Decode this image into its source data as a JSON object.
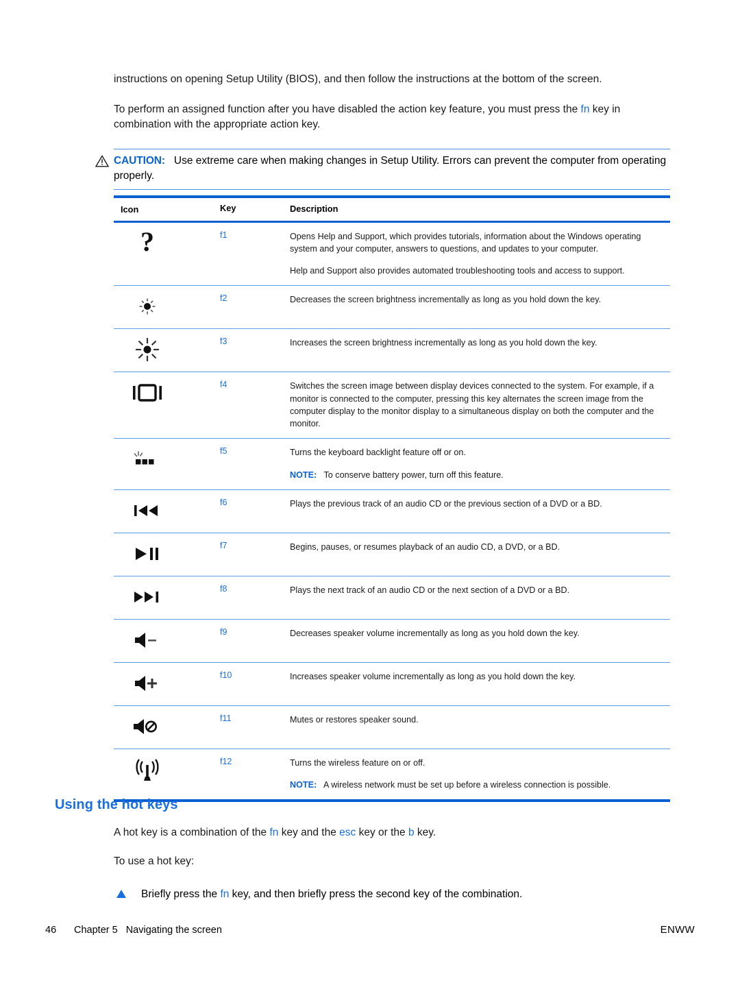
{
  "document": {
    "intro_paragraphs": [
      {
        "segments": [
          {
            "text": "instructions on opening Setup Utility (BIOS), and then follow the instructions at the bottom of the screen.",
            "style": "normal"
          }
        ]
      },
      {
        "segments": [
          {
            "text": "To perform an assigned function after you have disabled the action key feature, you must press the ",
            "style": "normal"
          },
          {
            "text": "fn",
            "style": "key"
          },
          {
            "text": " key in combination with the appropriate action key.",
            "style": "normal"
          }
        ]
      }
    ],
    "caution": {
      "icon": "warning-triangle-icon",
      "label": "CAUTION:",
      "text": "Use extreme care when making changes in Setup Utility. Errors can prevent the computer from operating properly."
    },
    "table": {
      "headers": [
        "Icon",
        "Key",
        "Description"
      ],
      "rows": [
        {
          "icon": "question-mark-icon",
          "key": "f1",
          "description": [
            "Opens Help and Support, which provides tutorials, information about the Windows operating system and your computer, answers to questions, and updates to your computer.",
            "Help and Support also provides automated troubleshooting tools and access to support."
          ]
        },
        {
          "icon": "brightness-decrease-icon",
          "key": "f2",
          "description": [
            "Decreases the screen brightness incrementally as long as you hold down the key."
          ]
        },
        {
          "icon": "brightness-increase-icon",
          "key": "f3",
          "description": [
            "Increases the screen brightness incrementally as long as you hold down the key."
          ]
        },
        {
          "icon": "switch-display-icon",
          "key": "f4",
          "description": [
            "Switches the screen image between display devices connected to the system. For example, if a monitor is connected to the computer, pressing this key alternates the screen image from the computer display to the monitor display to a simultaneous display on both the computer and the monitor."
          ]
        },
        {
          "icon": "keyboard-backlight-icon",
          "key": "f5",
          "description": [
            "Turns the keyboard backlight feature off or on."
          ],
          "note_label": "NOTE:",
          "note_text": "To conserve battery power, turn off this feature."
        },
        {
          "icon": "previous-track-icon",
          "key": "f6",
          "description": [
            "Plays the previous track of an audio CD or the previous section of a DVD or a BD."
          ]
        },
        {
          "icon": "play-pause-icon",
          "key": "f7",
          "description": [
            "Begins, pauses, or resumes playback of an audio CD, a DVD, or a BD."
          ]
        },
        {
          "icon": "next-track-icon",
          "key": "f8",
          "description": [
            "Plays the next track of an audio CD or the next section of a DVD or a BD."
          ]
        },
        {
          "icon": "volume-down-icon",
          "key": "f9",
          "description": [
            "Decreases speaker volume incrementally as long as you hold down the key."
          ]
        },
        {
          "icon": "volume-up-icon",
          "key": "f10",
          "description": [
            "Increases speaker volume incrementally as long as you hold down the key."
          ]
        },
        {
          "icon": "volume-mute-icon",
          "key": "f11",
          "description": [
            "Mutes or restores speaker sound."
          ]
        },
        {
          "icon": "wireless-icon",
          "key": "f12",
          "description": [
            "Turns the wireless feature on or off."
          ],
          "note_label": "NOTE:",
          "note_text": "A wireless network must be set up before a wireless connection is possible."
        }
      ]
    },
    "section": {
      "heading": "Using the hot keys",
      "paragraph_segments": [
        {
          "text": "A hot key is a combination of the ",
          "style": "normal"
        },
        {
          "text": "fn",
          "style": "key"
        },
        {
          "text": " key and the ",
          "style": "normal"
        },
        {
          "text": "esc",
          "style": "key"
        },
        {
          "text": " key or the ",
          "style": "normal"
        },
        {
          "text": "b",
          "style": "key"
        },
        {
          "text": " key.",
          "style": "normal"
        }
      ],
      "intro": "To use a hot key:",
      "bullet_segments": [
        {
          "text": "Briefly press the ",
          "style": "normal"
        },
        {
          "text": "fn",
          "style": "key"
        },
        {
          "text": " key, and then briefly press the second key of the combination.",
          "style": "normal"
        }
      ]
    },
    "footer": {
      "page_number": "46",
      "chapter": "Chapter 5",
      "chapter_title": "Navigating the screen",
      "right_label": "ENWW"
    },
    "colors": {
      "link_blue": "#1a6fe0",
      "rule_blue": "#0b5fd0",
      "thin_rule_blue": "#5b9ae5"
    }
  }
}
